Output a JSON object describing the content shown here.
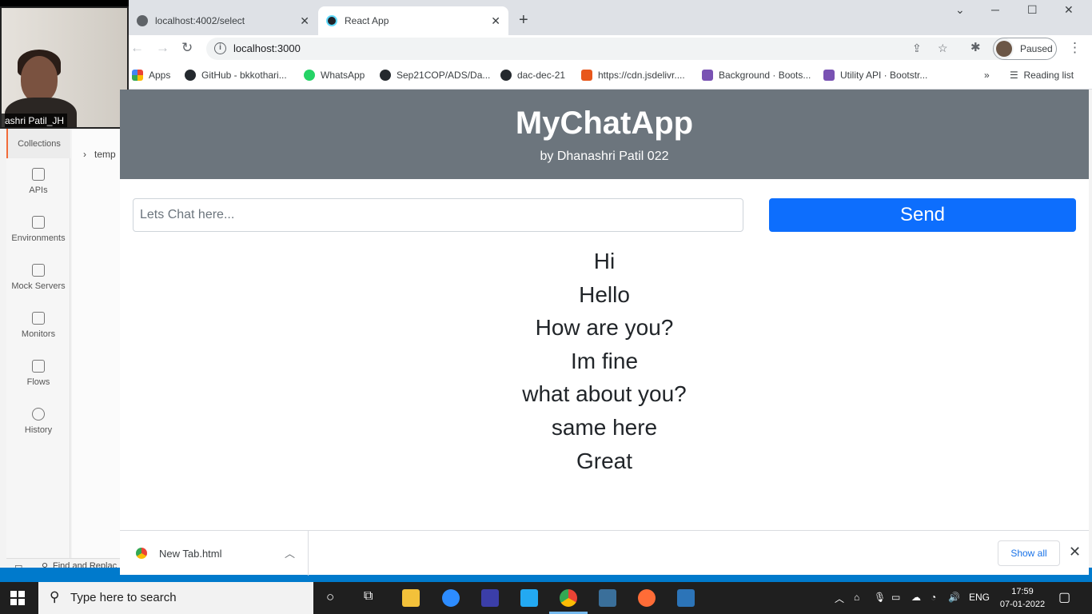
{
  "webcam": {
    "name": "ashri Patil_JH"
  },
  "postman": {
    "rail": [
      {
        "label": "Collections",
        "icon": "collections-icon"
      },
      {
        "label": "APIs",
        "icon": "apis-icon"
      },
      {
        "label": "Environments",
        "icon": "environments-icon"
      },
      {
        "label": "Mock Servers",
        "icon": "mock-servers-icon"
      },
      {
        "label": "Monitors",
        "icon": "monitors-icon"
      },
      {
        "label": "Flows",
        "icon": "flows-icon"
      },
      {
        "label": "History",
        "icon": "history-icon"
      }
    ],
    "tree_item": "temp",
    "find_replace": "Find and Replac"
  },
  "browser": {
    "tabs": [
      {
        "title": "localhost:4002/select",
        "active": false
      },
      {
        "title": "React App",
        "active": true
      }
    ],
    "url": "localhost:3000",
    "profile_status": "Paused",
    "bookmarks": [
      {
        "label": "Apps"
      },
      {
        "label": "GitHub - bkkothari..."
      },
      {
        "label": "WhatsApp"
      },
      {
        "label": "Sep21COP/ADS/Da..."
      },
      {
        "label": "dac-dec-21"
      },
      {
        "label": "https://cdn.jsdelivr...."
      },
      {
        "label": "Background · Boots..."
      },
      {
        "label": "Utility API · Bootstr..."
      }
    ],
    "reading_list": "Reading list"
  },
  "app": {
    "title": "MyChatApp",
    "subtitle": "by Dhanashri Patil 022",
    "input_placeholder": "Lets Chat here...",
    "send_label": "Send",
    "messages": [
      "Hi",
      "Hello",
      "How are you?",
      "Im fine",
      "what about you?",
      "same here",
      "Great"
    ]
  },
  "downloads": {
    "file": "New Tab.html",
    "show_all": "Show all"
  },
  "taskbar": {
    "search_placeholder": "Type here to search",
    "language": "ENG",
    "time": "17:59",
    "date": "07-01-2022"
  },
  "colors": {
    "hero_bg": "#6c757d",
    "send_bg": "#0d6efd",
    "vscode_status": "#007acc"
  }
}
